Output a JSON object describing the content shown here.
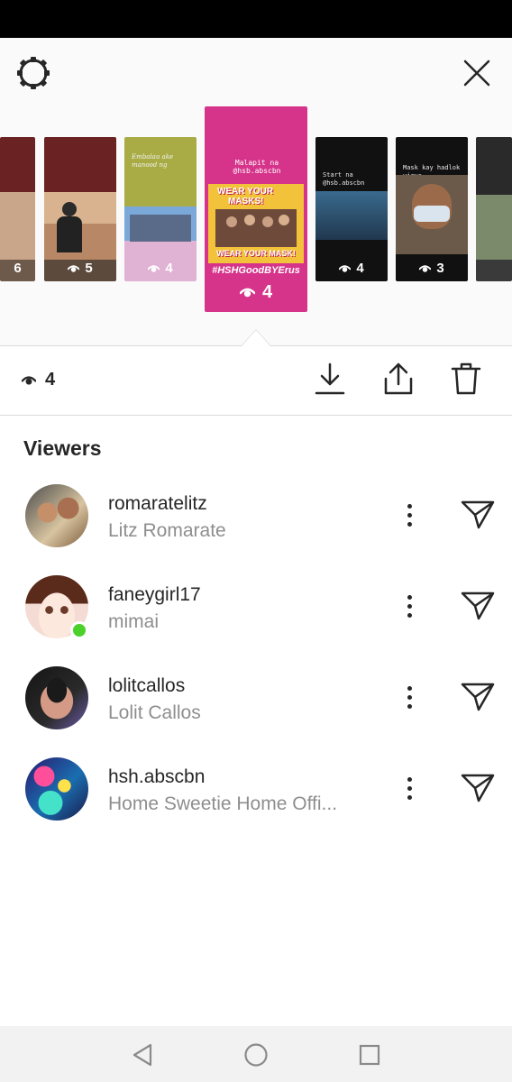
{
  "summary": {
    "view_count": "4"
  },
  "viewers_title": "Viewers",
  "stories": [
    {
      "count": "6"
    },
    {
      "count": "5"
    },
    {
      "count": "4",
      "caption": "Embalau ake manood ng"
    },
    {
      "count": "4",
      "caption": "Malapit na @hsb.abscbn",
      "sticker_line1": "WEAR YOUR",
      "sticker_line2": "MASKS!",
      "banner": "WEAR YOUR MASK!",
      "hashtag": "#HSHGoodBYErus"
    },
    {
      "count": "4",
      "caption": "Start na @hsb.abscbn"
    },
    {
      "count": "3",
      "caption": "Mask kay hadlok virus"
    },
    {
      "count": ""
    }
  ],
  "viewers": [
    {
      "username": "romaratelitz",
      "full_name": "Litz Romarate",
      "online": false
    },
    {
      "username": "faneygirl17",
      "full_name": "mimai",
      "online": true
    },
    {
      "username": "lolitcallos",
      "full_name": "Lolit Callos",
      "online": false
    },
    {
      "username": "hsh.abscbn",
      "full_name": "Home Sweetie Home Offi...",
      "online": false
    }
  ],
  "colors": {
    "accent_pink": "#d6338a",
    "online_green": "#4bd12a",
    "secondary_text": "#8e8e8e"
  },
  "icons": [
    "settings-icon",
    "close-icon",
    "eye-icon",
    "download-icon",
    "share-icon",
    "delete-icon",
    "more-icon",
    "send-icon",
    "back-icon",
    "home-icon",
    "recents-icon"
  ]
}
